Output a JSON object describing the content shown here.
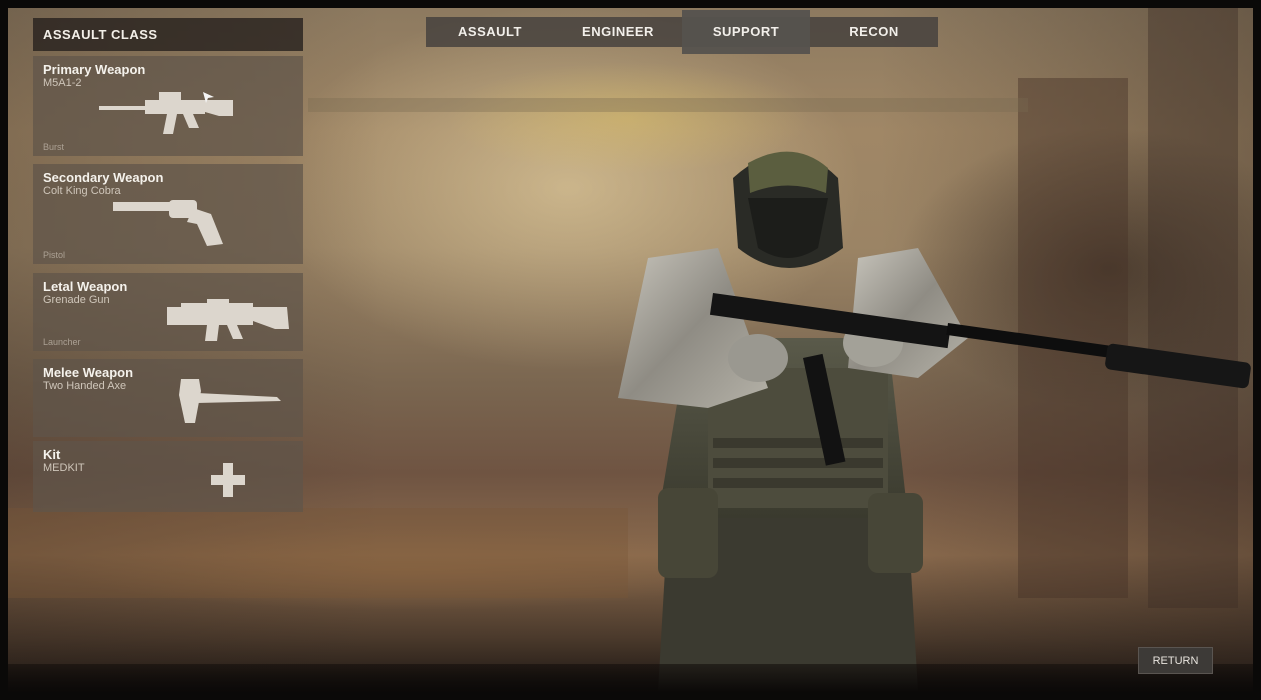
{
  "panel": {
    "title": "ASSAULT CLASS"
  },
  "slots": [
    {
      "name": "Primary Weapon",
      "item": "M5A1-2",
      "type": "Burst",
      "icon": "assault-rifle-icon"
    },
    {
      "name": "Secondary Weapon",
      "item": "Colt King Cobra",
      "type": "Pistol",
      "icon": "revolver-icon"
    },
    {
      "name": "Letal Weapon",
      "item": "Grenade Gun",
      "type": "Launcher",
      "icon": "grenade-launcher-icon"
    },
    {
      "name": "Melee Weapon",
      "item": "Two Handed Axe",
      "type": "",
      "icon": "axe-icon"
    },
    {
      "name": "Kit",
      "item": "MEDKIT",
      "type": "",
      "icon": "plus-icon"
    }
  ],
  "tabs": [
    {
      "label": "ASSAULT",
      "active": false
    },
    {
      "label": "ENGINEER",
      "active": false
    },
    {
      "label": "SUPPORT",
      "active": true
    },
    {
      "label": "RECON",
      "active": false
    }
  ],
  "footer": {
    "return_label": "RETURN"
  },
  "colors": {
    "panel": "#5f544a",
    "tab_bar": "#46423e",
    "text": "#f5f2ec"
  }
}
